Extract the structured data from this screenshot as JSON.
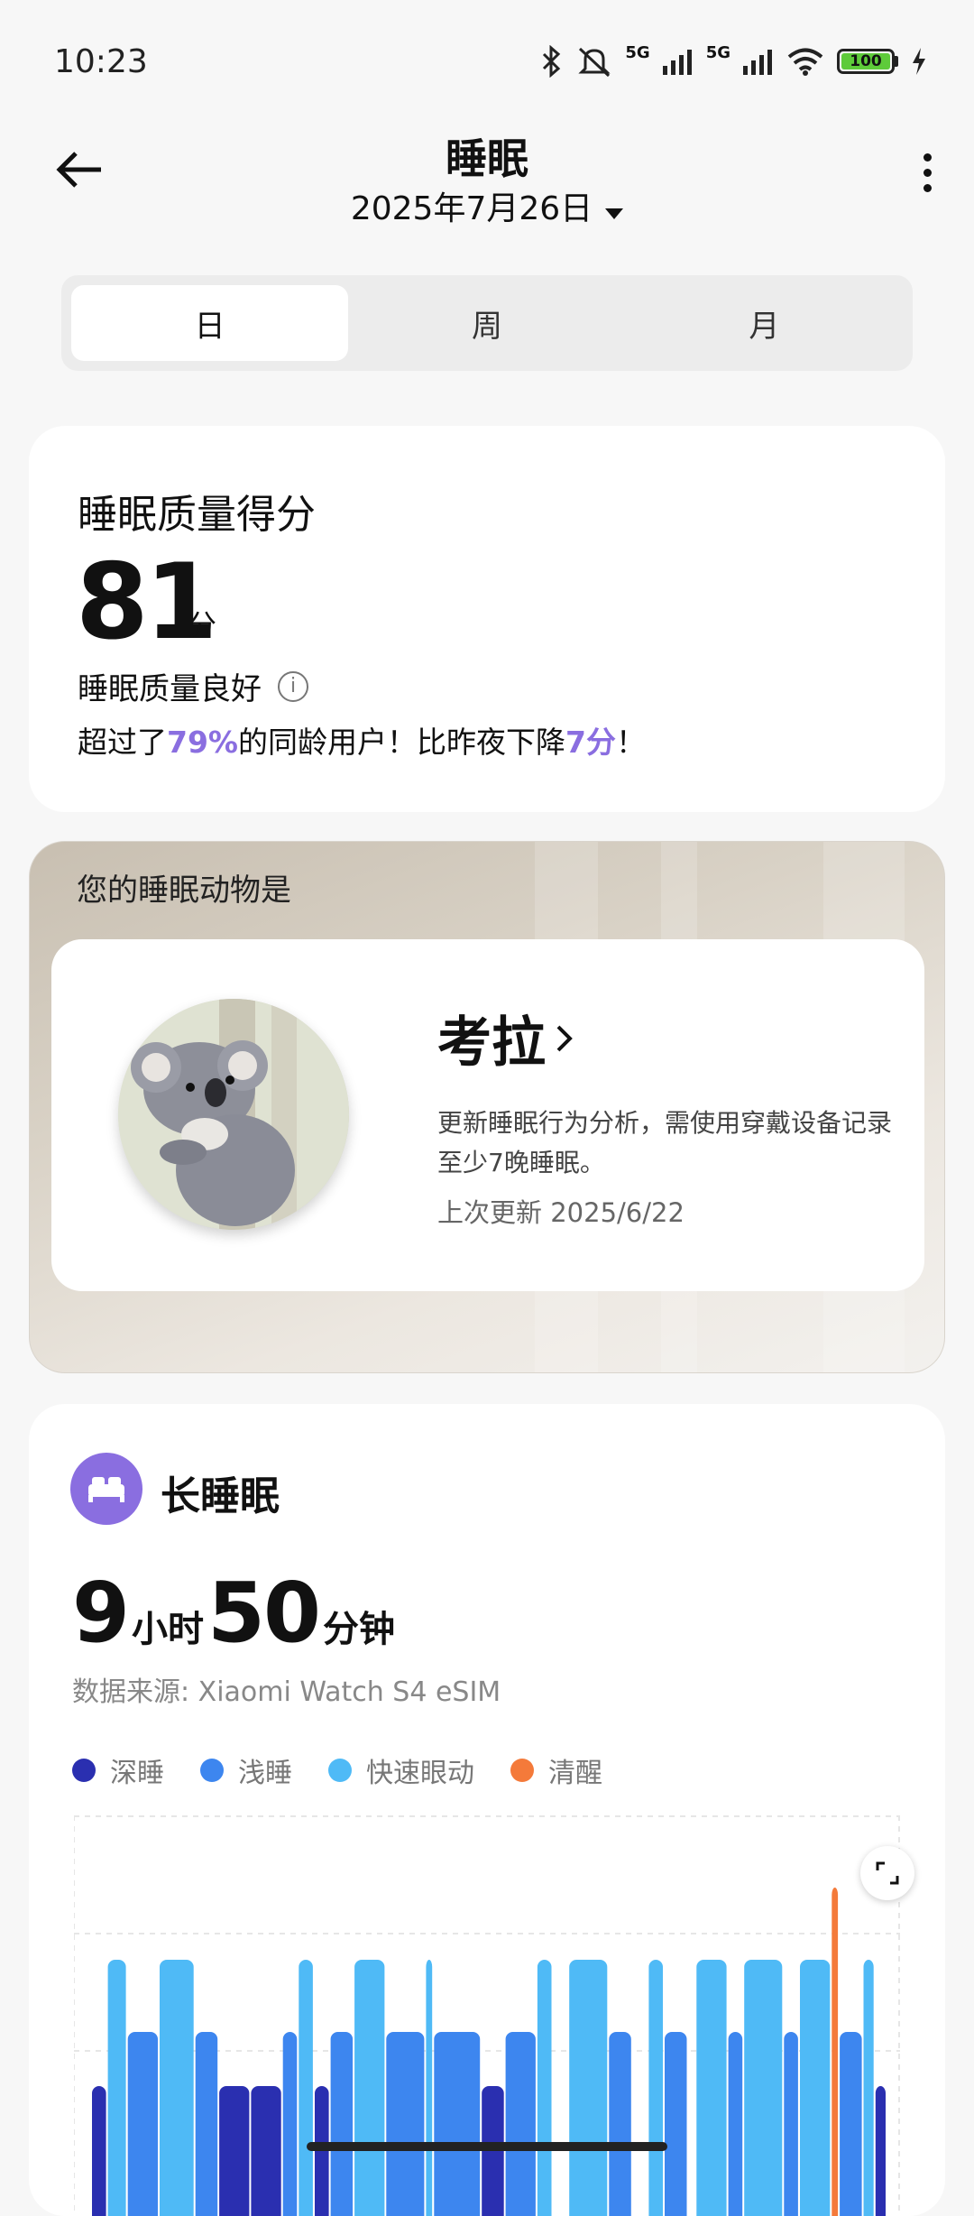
{
  "status_bar": {
    "time": "10:23",
    "battery": "100",
    "net1": "5G",
    "net2": "5G",
    "icons": [
      "bluetooth-icon",
      "mute-bell-icon",
      "signal-icon",
      "signal-icon",
      "wifi-icon",
      "battery-icon",
      "charging-icon"
    ]
  },
  "header": {
    "title": "睡眠",
    "date": "2025年7月26日"
  },
  "tabs": [
    {
      "label": "日",
      "active": true
    },
    {
      "label": "周",
      "active": false
    },
    {
      "label": "月",
      "active": false
    }
  ],
  "score_card": {
    "title": "睡眠质量得分",
    "value": "81",
    "unit": "分",
    "quality": "睡眠质量良好",
    "compare_prefix": "超过了",
    "compare_pct": "79%",
    "compare_mid": "的同龄用户！比昨夜下降",
    "compare_drop": "7分",
    "compare_suffix": "！"
  },
  "animal_card": {
    "heading": "您的睡眠动物是",
    "name": "考拉",
    "desc": "更新睡眠行为分析，需使用穿戴设备记录至少7晚睡眠。",
    "updated": "上次更新 2025/6/22"
  },
  "sleep_card": {
    "type": "长睡眠",
    "hours": "9",
    "hours_unit": "小时",
    "minutes": "50",
    "minutes_unit": "分钟",
    "source": "数据来源: Xiaomi Watch S4 eSIM",
    "legend": [
      {
        "label": "深睡",
        "color": "#2a2fb0"
      },
      {
        "label": "浅睡",
        "color": "#3d86ef"
      },
      {
        "label": "快速眼动",
        "color": "#4fbaf6"
      },
      {
        "label": "清醒",
        "color": "#f47a3a"
      }
    ]
  },
  "colors": {
    "accent": "#8a6ee0",
    "deep": "#2a2fb0",
    "light": "#3d86ef",
    "rem": "#4fbaf6",
    "awake": "#f47a3a"
  },
  "chart_data": {
    "type": "bar",
    "stage_order": [
      "深睡",
      "浅睡",
      "快速眼动",
      "清醒"
    ],
    "segments": [
      {
        "stage": "深睡",
        "span": [
          0.0,
          0.02
        ]
      },
      {
        "stage": "快速眼动",
        "span": [
          0.02,
          0.045
        ]
      },
      {
        "stage": "浅睡",
        "span": [
          0.045,
          0.085
        ]
      },
      {
        "stage": "快速眼动",
        "span": [
          0.085,
          0.13
        ]
      },
      {
        "stage": "浅睡",
        "span": [
          0.13,
          0.16
        ]
      },
      {
        "stage": "深睡",
        "span": [
          0.16,
          0.2
        ]
      },
      {
        "stage": "深睡",
        "span": [
          0.2,
          0.24
        ]
      },
      {
        "stage": "浅睡",
        "span": [
          0.24,
          0.26
        ]
      },
      {
        "stage": "快速眼动",
        "span": [
          0.26,
          0.28
        ]
      },
      {
        "stage": "深睡",
        "span": [
          0.28,
          0.3
        ]
      },
      {
        "stage": "浅睡",
        "span": [
          0.3,
          0.33
        ]
      },
      {
        "stage": "快速眼动",
        "span": [
          0.33,
          0.37
        ]
      },
      {
        "stage": "浅睡",
        "span": [
          0.37,
          0.42
        ]
      },
      {
        "stage": "快速眼动",
        "span": [
          0.42,
          0.43
        ]
      },
      {
        "stage": "浅睡",
        "span": [
          0.43,
          0.49
        ]
      },
      {
        "stage": "深睡",
        "span": [
          0.49,
          0.52
        ]
      },
      {
        "stage": "浅睡",
        "span": [
          0.52,
          0.56
        ]
      },
      {
        "stage": "快速眼动",
        "span": [
          0.56,
          0.58
        ]
      },
      {
        "stage": "快速眼动",
        "span": [
          0.6,
          0.65
        ]
      },
      {
        "stage": "浅睡",
        "span": [
          0.65,
          0.68
        ]
      },
      {
        "stage": "快速眼动",
        "span": [
          0.7,
          0.72
        ]
      },
      {
        "stage": "浅睡",
        "span": [
          0.72,
          0.75
        ]
      },
      {
        "stage": "快速眼动",
        "span": [
          0.76,
          0.8
        ]
      },
      {
        "stage": "浅睡",
        "span": [
          0.8,
          0.82
        ]
      },
      {
        "stage": "快速眼动",
        "span": [
          0.82,
          0.87
        ]
      },
      {
        "stage": "浅睡",
        "span": [
          0.87,
          0.89
        ]
      },
      {
        "stage": "快速眼动",
        "span": [
          0.89,
          0.93
        ]
      },
      {
        "stage": "清醒",
        "span": [
          0.93,
          0.94
        ]
      },
      {
        "stage": "浅睡",
        "span": [
          0.94,
          0.97
        ]
      },
      {
        "stage": "快速眼动",
        "span": [
          0.97,
          0.985
        ]
      },
      {
        "stage": "深睡",
        "span": [
          0.985,
          1.0
        ]
      }
    ],
    "grid": true,
    "legend_position": "top"
  }
}
